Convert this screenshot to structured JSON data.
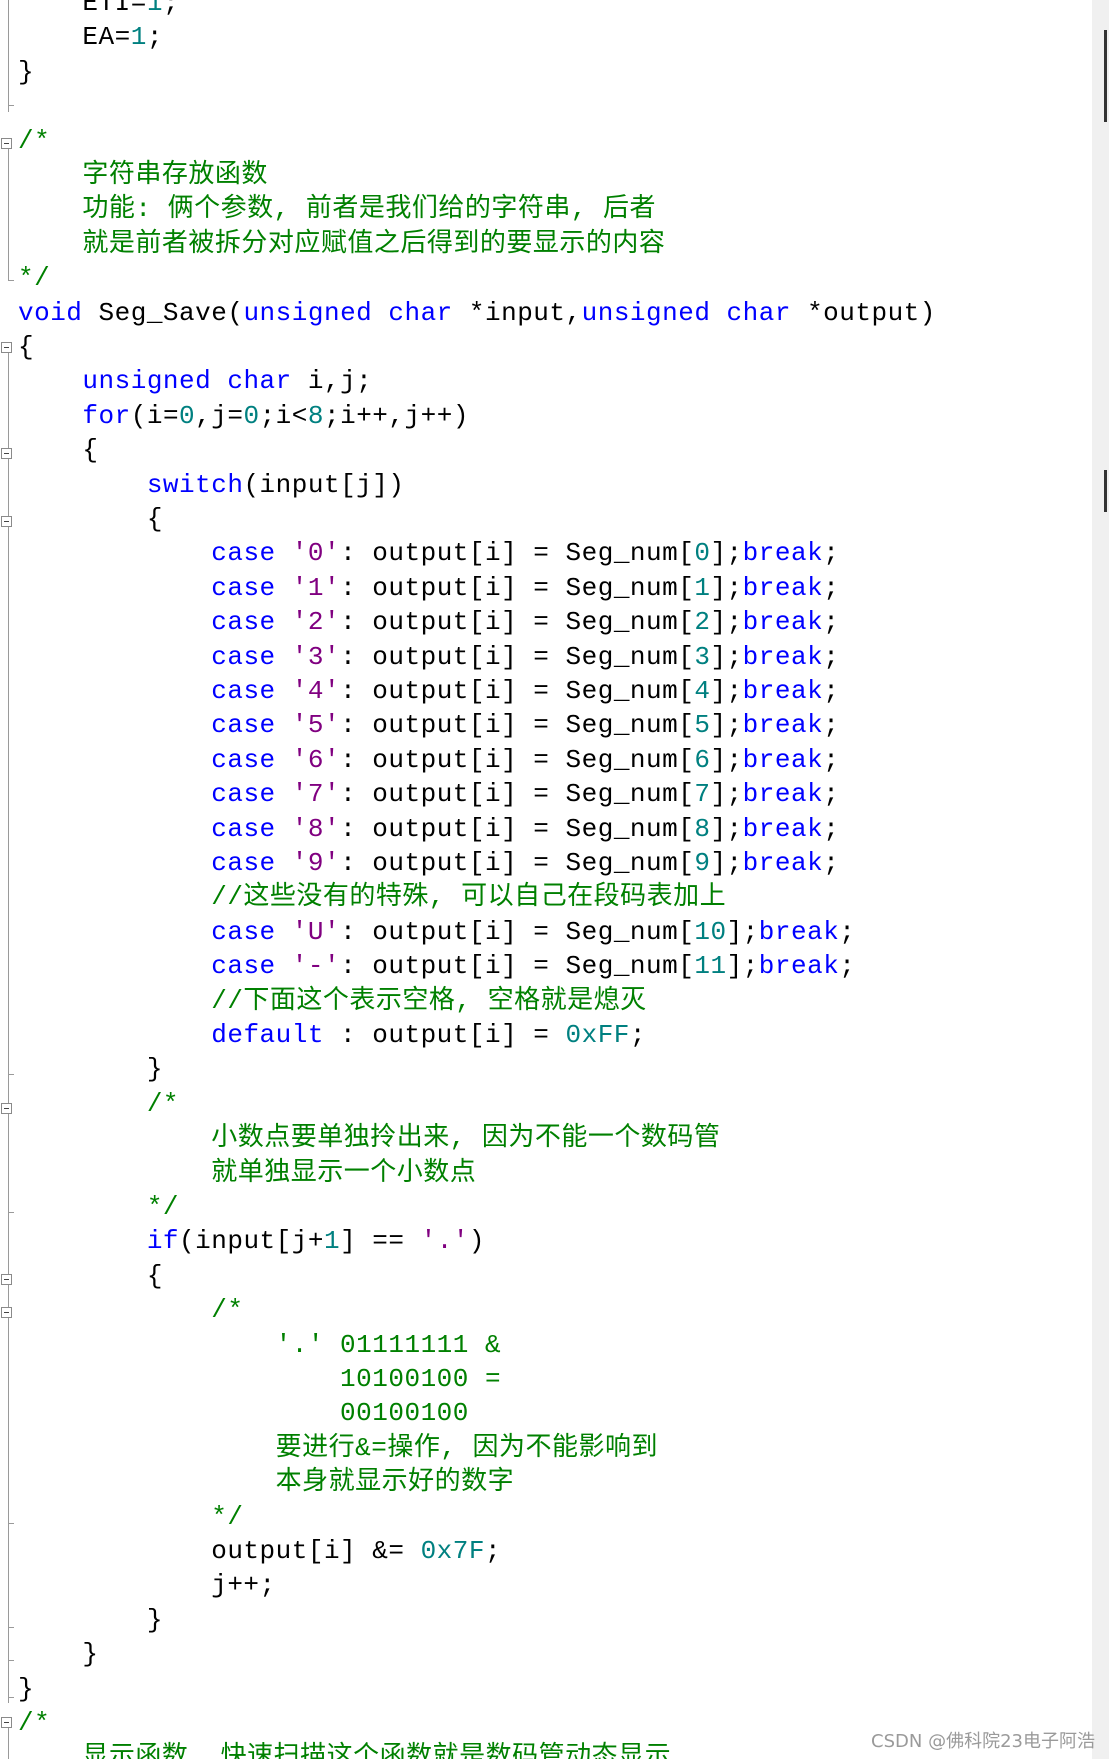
{
  "editor": {
    "colors": {
      "background": "#ffffff",
      "keyword": "#0000ff",
      "comment": "#008000",
      "number": "#008080",
      "char_literal": "#800080",
      "text": "#000000"
    },
    "lines": [
      [
        {
          "t": "    ETI=",
          "c": ""
        },
        {
          "t": "1",
          "c": "num"
        },
        {
          "t": ";",
          "c": ""
        }
      ],
      [
        {
          "t": "    EA=",
          "c": ""
        },
        {
          "t": "1",
          "c": "num"
        },
        {
          "t": ";",
          "c": ""
        }
      ],
      [
        {
          "t": "}",
          "c": ""
        }
      ],
      [],
      [
        {
          "t": "/*",
          "c": "cm"
        }
      ],
      [
        {
          "t": "    字符串存放函数",
          "c": "cm"
        }
      ],
      [
        {
          "t": "    功能: 俩个参数, 前者是我们给的字符串, 后者",
          "c": "cm"
        }
      ],
      [
        {
          "t": "    就是前者被拆分对应赋值之后得到的要显示的内容",
          "c": "cm"
        }
      ],
      [
        {
          "t": "*/",
          "c": "cm"
        }
      ],
      [
        {
          "t": "void",
          "c": "kw"
        },
        {
          "t": " Seg_Save(",
          "c": ""
        },
        {
          "t": "unsigned char",
          "c": "kw"
        },
        {
          "t": " *input,",
          "c": ""
        },
        {
          "t": "unsigned char",
          "c": "kw"
        },
        {
          "t": " *output)",
          "c": ""
        }
      ],
      [
        {
          "t": "{",
          "c": ""
        }
      ],
      [
        {
          "t": "    ",
          "c": ""
        },
        {
          "t": "unsigned char",
          "c": "kw"
        },
        {
          "t": " i,j;",
          "c": ""
        }
      ],
      [
        {
          "t": "    ",
          "c": ""
        },
        {
          "t": "for",
          "c": "kw"
        },
        {
          "t": "(i=",
          "c": ""
        },
        {
          "t": "0",
          "c": "num"
        },
        {
          "t": ",j=",
          "c": ""
        },
        {
          "t": "0",
          "c": "num"
        },
        {
          "t": ";i<",
          "c": ""
        },
        {
          "t": "8",
          "c": "num"
        },
        {
          "t": ";i++,j++)",
          "c": ""
        }
      ],
      [
        {
          "t": "    {",
          "c": ""
        }
      ],
      [
        {
          "t": "        ",
          "c": ""
        },
        {
          "t": "switch",
          "c": "kw"
        },
        {
          "t": "(input[j])",
          "c": ""
        }
      ],
      [
        {
          "t": "        {",
          "c": ""
        }
      ],
      [
        {
          "t": "            ",
          "c": ""
        },
        {
          "t": "case",
          "c": "kw"
        },
        {
          "t": " ",
          "c": ""
        },
        {
          "t": "'0'",
          "c": "str"
        },
        {
          "t": ": output[i] = Seg_num[",
          "c": ""
        },
        {
          "t": "0",
          "c": "num"
        },
        {
          "t": "];",
          "c": ""
        },
        {
          "t": "break",
          "c": "kw"
        },
        {
          "t": ";",
          "c": ""
        }
      ],
      [
        {
          "t": "            ",
          "c": ""
        },
        {
          "t": "case",
          "c": "kw"
        },
        {
          "t": " ",
          "c": ""
        },
        {
          "t": "'1'",
          "c": "str"
        },
        {
          "t": ": output[i] = Seg_num[",
          "c": ""
        },
        {
          "t": "1",
          "c": "num"
        },
        {
          "t": "];",
          "c": ""
        },
        {
          "t": "break",
          "c": "kw"
        },
        {
          "t": ";",
          "c": ""
        }
      ],
      [
        {
          "t": "            ",
          "c": ""
        },
        {
          "t": "case",
          "c": "kw"
        },
        {
          "t": " ",
          "c": ""
        },
        {
          "t": "'2'",
          "c": "str"
        },
        {
          "t": ": output[i] = Seg_num[",
          "c": ""
        },
        {
          "t": "2",
          "c": "num"
        },
        {
          "t": "];",
          "c": ""
        },
        {
          "t": "break",
          "c": "kw"
        },
        {
          "t": ";",
          "c": ""
        }
      ],
      [
        {
          "t": "            ",
          "c": ""
        },
        {
          "t": "case",
          "c": "kw"
        },
        {
          "t": " ",
          "c": ""
        },
        {
          "t": "'3'",
          "c": "str"
        },
        {
          "t": ": output[i] = Seg_num[",
          "c": ""
        },
        {
          "t": "3",
          "c": "num"
        },
        {
          "t": "];",
          "c": ""
        },
        {
          "t": "break",
          "c": "kw"
        },
        {
          "t": ";",
          "c": ""
        }
      ],
      [
        {
          "t": "            ",
          "c": ""
        },
        {
          "t": "case",
          "c": "kw"
        },
        {
          "t": " ",
          "c": ""
        },
        {
          "t": "'4'",
          "c": "str"
        },
        {
          "t": ": output[i] = Seg_num[",
          "c": ""
        },
        {
          "t": "4",
          "c": "num"
        },
        {
          "t": "];",
          "c": ""
        },
        {
          "t": "break",
          "c": "kw"
        },
        {
          "t": ";",
          "c": ""
        }
      ],
      [
        {
          "t": "            ",
          "c": ""
        },
        {
          "t": "case",
          "c": "kw"
        },
        {
          "t": " ",
          "c": ""
        },
        {
          "t": "'5'",
          "c": "str"
        },
        {
          "t": ": output[i] = Seg_num[",
          "c": ""
        },
        {
          "t": "5",
          "c": "num"
        },
        {
          "t": "];",
          "c": ""
        },
        {
          "t": "break",
          "c": "kw"
        },
        {
          "t": ";",
          "c": ""
        }
      ],
      [
        {
          "t": "            ",
          "c": ""
        },
        {
          "t": "case",
          "c": "kw"
        },
        {
          "t": " ",
          "c": ""
        },
        {
          "t": "'6'",
          "c": "str"
        },
        {
          "t": ": output[i] = Seg_num[",
          "c": ""
        },
        {
          "t": "6",
          "c": "num"
        },
        {
          "t": "];",
          "c": ""
        },
        {
          "t": "break",
          "c": "kw"
        },
        {
          "t": ";",
          "c": ""
        }
      ],
      [
        {
          "t": "            ",
          "c": ""
        },
        {
          "t": "case",
          "c": "kw"
        },
        {
          "t": " ",
          "c": ""
        },
        {
          "t": "'7'",
          "c": "str"
        },
        {
          "t": ": output[i] = Seg_num[",
          "c": ""
        },
        {
          "t": "7",
          "c": "num"
        },
        {
          "t": "];",
          "c": ""
        },
        {
          "t": "break",
          "c": "kw"
        },
        {
          "t": ";",
          "c": ""
        }
      ],
      [
        {
          "t": "            ",
          "c": ""
        },
        {
          "t": "case",
          "c": "kw"
        },
        {
          "t": " ",
          "c": ""
        },
        {
          "t": "'8'",
          "c": "str"
        },
        {
          "t": ": output[i] = Seg_num[",
          "c": ""
        },
        {
          "t": "8",
          "c": "num"
        },
        {
          "t": "];",
          "c": ""
        },
        {
          "t": "break",
          "c": "kw"
        },
        {
          "t": ";",
          "c": ""
        }
      ],
      [
        {
          "t": "            ",
          "c": ""
        },
        {
          "t": "case",
          "c": "kw"
        },
        {
          "t": " ",
          "c": ""
        },
        {
          "t": "'9'",
          "c": "str"
        },
        {
          "t": ": output[i] = Seg_num[",
          "c": ""
        },
        {
          "t": "9",
          "c": "num"
        },
        {
          "t": "];",
          "c": ""
        },
        {
          "t": "break",
          "c": "kw"
        },
        {
          "t": ";",
          "c": ""
        }
      ],
      [
        {
          "t": "            //这些没有的特殊, 可以自己在段码表加上",
          "c": "cm"
        }
      ],
      [
        {
          "t": "            ",
          "c": ""
        },
        {
          "t": "case",
          "c": "kw"
        },
        {
          "t": " ",
          "c": ""
        },
        {
          "t": "'U'",
          "c": "str"
        },
        {
          "t": ": output[i] = Seg_num[",
          "c": ""
        },
        {
          "t": "10",
          "c": "num"
        },
        {
          "t": "];",
          "c": ""
        },
        {
          "t": "break",
          "c": "kw"
        },
        {
          "t": ";",
          "c": ""
        }
      ],
      [
        {
          "t": "            ",
          "c": ""
        },
        {
          "t": "case",
          "c": "kw"
        },
        {
          "t": " ",
          "c": ""
        },
        {
          "t": "'-'",
          "c": "str"
        },
        {
          "t": ": output[i] = Seg_num[",
          "c": ""
        },
        {
          "t": "11",
          "c": "num"
        },
        {
          "t": "];",
          "c": ""
        },
        {
          "t": "break",
          "c": "kw"
        },
        {
          "t": ";",
          "c": ""
        }
      ],
      [
        {
          "t": "            //下面这个表示空格, 空格就是熄灭",
          "c": "cm"
        }
      ],
      [
        {
          "t": "            ",
          "c": ""
        },
        {
          "t": "default",
          "c": "kw"
        },
        {
          "t": " : output[i] = ",
          "c": ""
        },
        {
          "t": "0xFF",
          "c": "num"
        },
        {
          "t": ";",
          "c": ""
        }
      ],
      [
        {
          "t": "        }",
          "c": ""
        }
      ],
      [
        {
          "t": "        /*",
          "c": "cm"
        }
      ],
      [
        {
          "t": "            小数点要单独拎出来, 因为不能一个数码管",
          "c": "cm"
        }
      ],
      [
        {
          "t": "            就单独显示一个小数点",
          "c": "cm"
        }
      ],
      [
        {
          "t": "        */",
          "c": "cm"
        }
      ],
      [
        {
          "t": "        ",
          "c": ""
        },
        {
          "t": "if",
          "c": "kw"
        },
        {
          "t": "(input[j+",
          "c": ""
        },
        {
          "t": "1",
          "c": "num"
        },
        {
          "t": "] == ",
          "c": ""
        },
        {
          "t": "'.'",
          "c": "str"
        },
        {
          "t": ")",
          "c": ""
        }
      ],
      [
        {
          "t": "        {",
          "c": ""
        }
      ],
      [
        {
          "t": "            /*",
          "c": "cm"
        }
      ],
      [
        {
          "t": "                '.' 01111111 &",
          "c": "cm"
        }
      ],
      [
        {
          "t": "                    10100100 =",
          "c": "cm"
        }
      ],
      [
        {
          "t": "                    00100100",
          "c": "cm"
        }
      ],
      [
        {
          "t": "                要进行&=操作, 因为不能影响到",
          "c": "cm"
        }
      ],
      [
        {
          "t": "                本身就显示好的数字",
          "c": "cm"
        }
      ],
      [
        {
          "t": "            */",
          "c": "cm"
        }
      ],
      [
        {
          "t": "            output[i] &= ",
          "c": ""
        },
        {
          "t": "0x7F",
          "c": "num"
        },
        {
          "t": ";",
          "c": ""
        }
      ],
      [
        {
          "t": "            j++;",
          "c": ""
        }
      ],
      [
        {
          "t": "        }",
          "c": ""
        }
      ],
      [
        {
          "t": "    }",
          "c": ""
        }
      ],
      [
        {
          "t": "}",
          "c": ""
        }
      ],
      [
        {
          "t": "/*",
          "c": "cm"
        }
      ],
      [
        {
          "t": "    显示函数, 快速扫描这个函数就是数码管动态显示",
          "c": "cm"
        }
      ]
    ]
  },
  "watermark": {
    "text": "CSDN @佛科院23电子阿浩"
  }
}
